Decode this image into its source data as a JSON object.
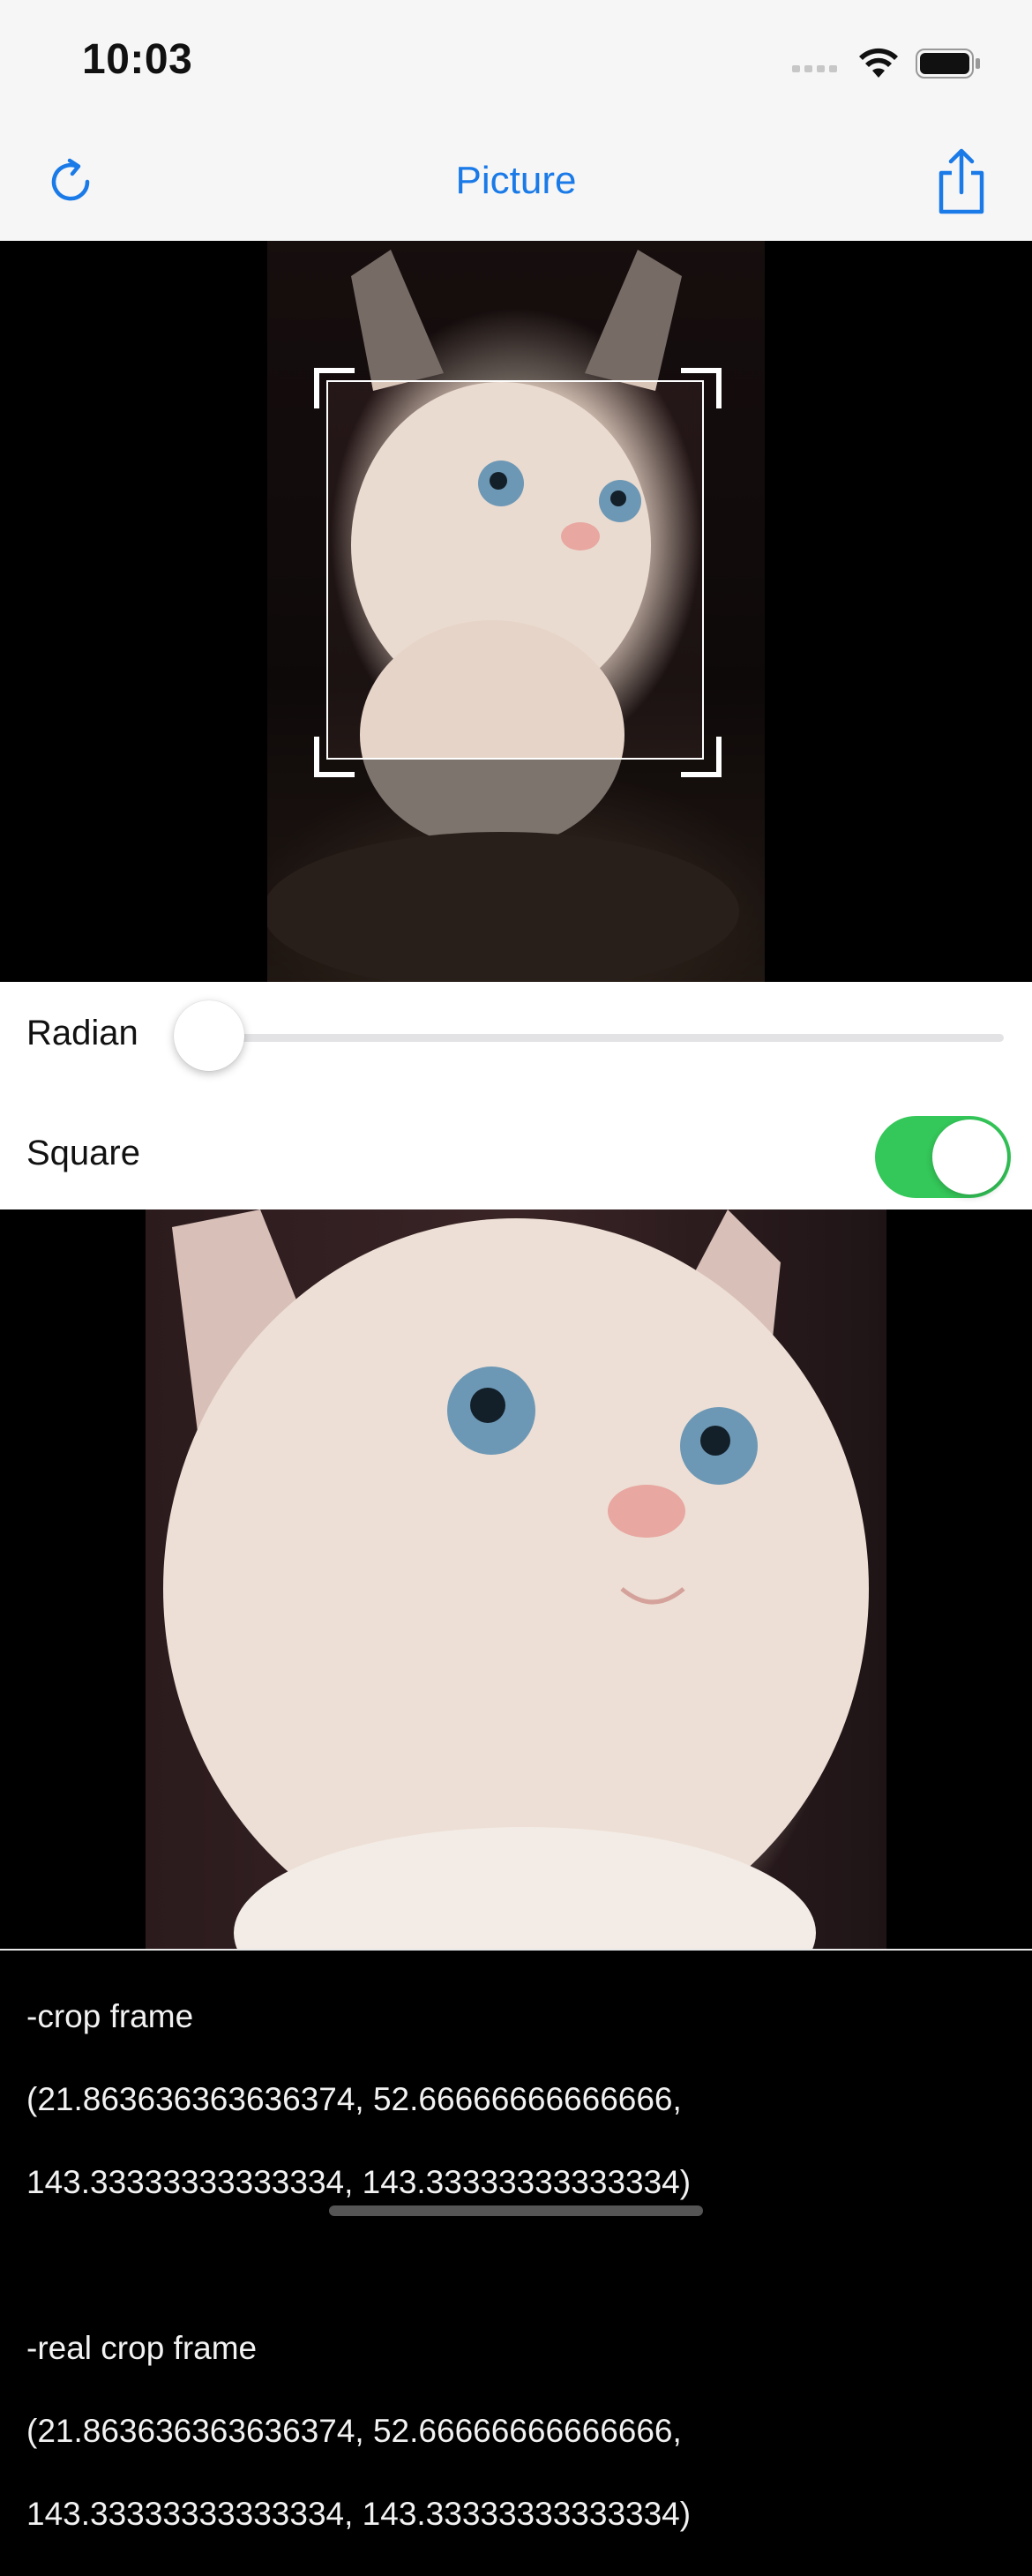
{
  "status_bar": {
    "time": "10:03"
  },
  "nav": {
    "title": "Picture",
    "left_icon": "refresh-icon",
    "right_icon": "share-icon",
    "accent": "#1a7ae8"
  },
  "controls": {
    "radian_label": "Radian",
    "radian_value": 0.0,
    "square_label": "Square",
    "square_on": true
  },
  "info": {
    "crop_frame_title": "-crop frame",
    "crop_frame_line1": "(21.863636363636374, 52.66666666666666,",
    "crop_frame_line2": "143.33333333333334, 143.33333333333334)",
    "real_crop_frame_title": "-real crop frame",
    "real_crop_frame_line1": "(21.863636363636374, 52.66666666666666,",
    "real_crop_frame_line2": "143.33333333333334, 143.33333333333334)"
  },
  "colors": {
    "toggle_on": "#34c759",
    "nav_bg": "#f6f6f6"
  }
}
